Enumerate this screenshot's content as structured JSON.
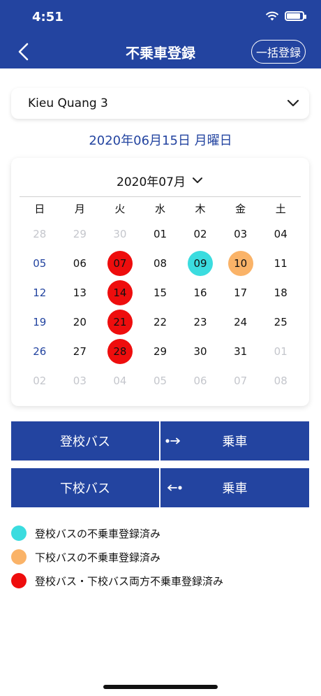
{
  "status_bar": {
    "time": "4:51"
  },
  "header": {
    "title": "不乗車登録",
    "bulk_button": "一括登録"
  },
  "student_select": {
    "value": "Kieu Quang 3"
  },
  "selected_date": "2020年06月15日 月曜日",
  "calendar": {
    "month_label": "2020年07月",
    "weekdays": [
      "日",
      "月",
      "火",
      "水",
      "木",
      "金",
      "土"
    ],
    "weeks": [
      [
        {
          "d": "28",
          "s": "muted"
        },
        {
          "d": "29",
          "s": "muted"
        },
        {
          "d": "30",
          "s": "muted"
        },
        {
          "d": "01",
          "s": ""
        },
        {
          "d": "02",
          "s": ""
        },
        {
          "d": "03",
          "s": ""
        },
        {
          "d": "04",
          "s": ""
        }
      ],
      [
        {
          "d": "05",
          "s": "sunday"
        },
        {
          "d": "06",
          "s": ""
        },
        {
          "d": "07",
          "s": "red"
        },
        {
          "d": "08",
          "s": ""
        },
        {
          "d": "09",
          "s": "cyan"
        },
        {
          "d": "10",
          "s": "orange"
        },
        {
          "d": "11",
          "s": ""
        }
      ],
      [
        {
          "d": "12",
          "s": "sunday"
        },
        {
          "d": "13",
          "s": ""
        },
        {
          "d": "14",
          "s": "red"
        },
        {
          "d": "15",
          "s": ""
        },
        {
          "d": "16",
          "s": ""
        },
        {
          "d": "17",
          "s": ""
        },
        {
          "d": "18",
          "s": ""
        }
      ],
      [
        {
          "d": "19",
          "s": "sunday"
        },
        {
          "d": "20",
          "s": ""
        },
        {
          "d": "21",
          "s": "red"
        },
        {
          "d": "22",
          "s": ""
        },
        {
          "d": "23",
          "s": ""
        },
        {
          "d": "24",
          "s": ""
        },
        {
          "d": "25",
          "s": ""
        }
      ],
      [
        {
          "d": "26",
          "s": "sunday"
        },
        {
          "d": "27",
          "s": ""
        },
        {
          "d": "28",
          "s": "red"
        },
        {
          "d": "29",
          "s": ""
        },
        {
          "d": "30",
          "s": ""
        },
        {
          "d": "31",
          "s": ""
        },
        {
          "d": "01",
          "s": "muted"
        }
      ],
      [
        {
          "d": "02",
          "s": "muted"
        },
        {
          "d": "03",
          "s": "muted"
        },
        {
          "d": "04",
          "s": "muted"
        },
        {
          "d": "05",
          "s": "muted"
        },
        {
          "d": "06",
          "s": "muted"
        },
        {
          "d": "07",
          "s": "muted"
        },
        {
          "d": "08",
          "s": "muted"
        }
      ]
    ]
  },
  "actions": {
    "to_school": {
      "label": "登校バス",
      "action": "乗車"
    },
    "from_school": {
      "label": "下校バス",
      "action": "乗車"
    }
  },
  "legend": [
    {
      "color": "#3bdcdf",
      "text": "登校バスの不乗車登録済み"
    },
    {
      "color": "#fab368",
      "text": "下校バスの不乗車登録済み"
    },
    {
      "color": "#ee0d0d",
      "text": "登校バス・下校バス両方不乗車登録済み"
    }
  ],
  "colors": {
    "primary": "#2344a0",
    "red": "#ee0d0d",
    "cyan": "#3bdcdf",
    "orange": "#fab368"
  }
}
